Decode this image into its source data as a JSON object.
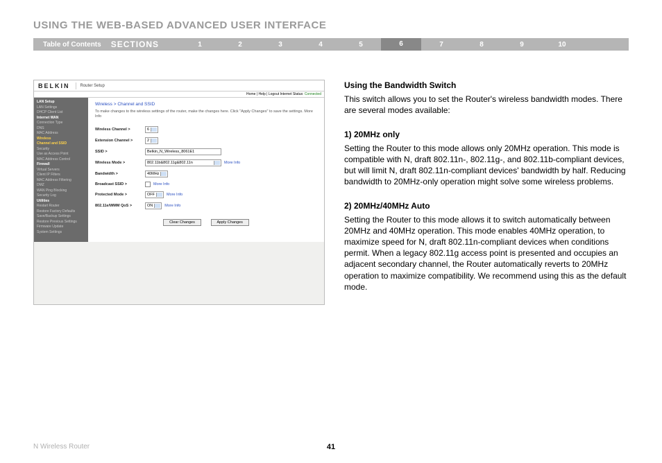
{
  "title": "USING THE WEB-BASED ADVANCED USER INTERFACE",
  "nav": {
    "toc": "Table of Contents",
    "sections": "SECTIONS",
    "items": [
      "1",
      "2",
      "3",
      "4",
      "5",
      "6",
      "7",
      "8",
      "9",
      "10"
    ],
    "active": "6"
  },
  "shot": {
    "brand": "BELKIN",
    "setup": "Router Setup",
    "toplinks": "Home | Help | Logout   Internet Status:",
    "conn": "Connected",
    "sidebar": [
      {
        "t": "LAN Setup",
        "c": "cat"
      },
      {
        "t": "LAN Settings"
      },
      {
        "t": "DHCP Client List"
      },
      {
        "t": "Internet WAN",
        "c": "cat"
      },
      {
        "t": "Connection Type"
      },
      {
        "t": "DNS"
      },
      {
        "t": "MAC Address"
      },
      {
        "t": "Wireless",
        "c": "hl"
      },
      {
        "t": "Channel and SSID",
        "c": "hl"
      },
      {
        "t": "Security"
      },
      {
        "t": "Use as Access Point"
      },
      {
        "t": "MAC Address Control"
      },
      {
        "t": "Firewall",
        "c": "cat"
      },
      {
        "t": "Virtual Servers"
      },
      {
        "t": "Client IP Filters"
      },
      {
        "t": "MAC Address Filtering"
      },
      {
        "t": "DMZ"
      },
      {
        "t": "WAN Ping Blocking"
      },
      {
        "t": "Security Log"
      },
      {
        "t": "Utilities",
        "c": "cat"
      },
      {
        "t": "Restart Router"
      },
      {
        "t": "Restore Factory Defaults"
      },
      {
        "t": "Save/Backup Settings"
      },
      {
        "t": "Restore Previous Settings"
      },
      {
        "t": "Firmware Update"
      },
      {
        "t": "System Settings"
      }
    ],
    "crumb": "Wireless > Channel and SSID",
    "note": "To make changes to the wireless settings of the router, make the changes here. Click \"Apply Changes\" to save the settings. More Info",
    "rows": {
      "r1": {
        "lbl": "Wireless Channel >",
        "val": "6"
      },
      "r2": {
        "lbl": "Extension Channel >",
        "val": "2"
      },
      "r3": {
        "lbl": "SSID >",
        "val": "Belkin_N_Wireless_8061E1"
      },
      "r4": {
        "lbl": "Wireless Mode >",
        "val": "802.11b&802.11g&802.11n",
        "more": "More Info"
      },
      "r5": {
        "lbl": "Bandwidth >",
        "val": "40MHz",
        "more": ""
      },
      "r6": {
        "lbl": "Broadcast SSID >",
        "more": "More Info"
      },
      "r7": {
        "lbl": "Protected Mode >",
        "val": "OFF",
        "more": "More Info"
      },
      "r8": {
        "lbl": "802.11e/WMM QoS >",
        "val": "ON",
        "more": "More Info"
      }
    },
    "btn_clear": "Clear Changes",
    "btn_apply": "Apply Changes"
  },
  "text": {
    "h1": "Using the Bandwidth Switch",
    "p1": "This switch allows you to set the Router's wireless bandwidth modes. There are several modes available:",
    "s1": "1) 20MHz only",
    "p2": "Setting the Router to this mode allows only 20MHz operation. This mode is compatible with N, draft 802.11n-, 802.11g-, and 802.11b-compliant devices, but will limit N, draft 802.11n-compliant devices' bandwidth by half. Reducing bandwidth to 20MHz-only operation might solve some wireless problems.",
    "s2": "2) 20MHz/40MHz Auto",
    "p3": "Setting the Router to this mode allows it to switch automatically between 20MHz and 40MHz operation. This mode enables 40MHz operation, to maximize speed for N, draft 802.11n-compliant devices when conditions permit. When a legacy 802.11g access point is presented and occupies an adjacent secondary channel, the Router automatically reverts to 20MHz operation to maximize compatibility. We recommend using this as the default mode."
  },
  "footer": {
    "product": "N Wireless Router",
    "page": "41"
  }
}
